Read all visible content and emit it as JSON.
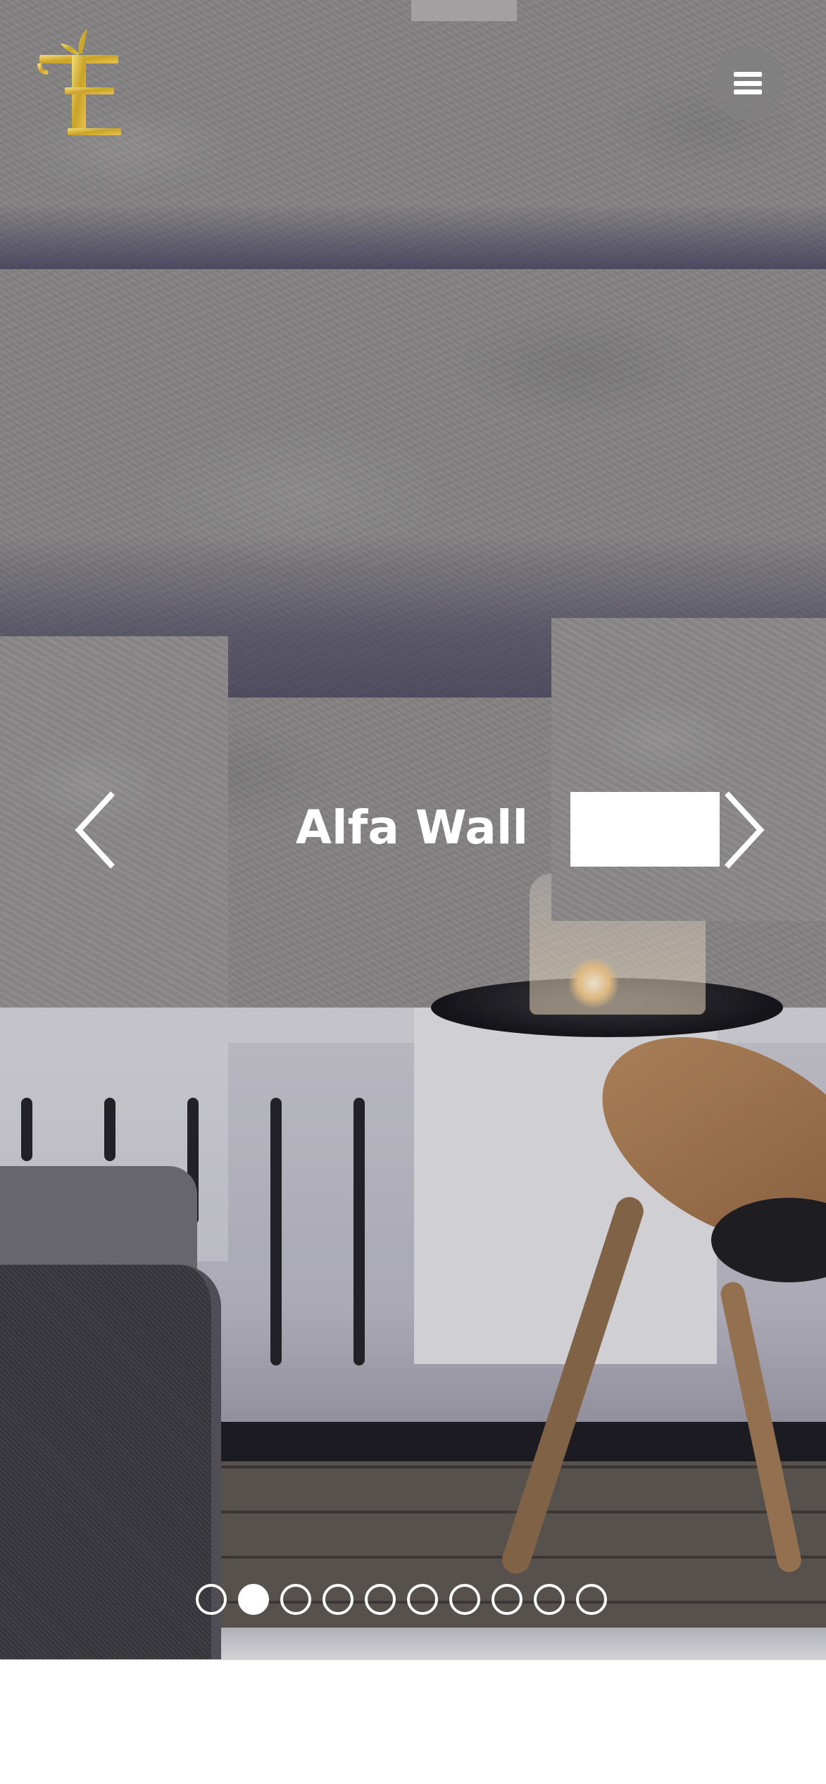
{
  "header": {
    "logo_icon": "gold-letter-e-sprout-logo",
    "menu_icon": "hamburger-menu-icon"
  },
  "slider": {
    "title": "Alfa Wall",
    "button_label": "",
    "prev_icon": "chevron-left-icon",
    "next_icon": "chevron-right-icon",
    "slide_count": 10,
    "active_index": 1
  },
  "colors": {
    "logo_gold": "#C9A227",
    "text": "#FFFFFF",
    "wall": "#8F8D8B",
    "accent_purple": "#46425F"
  }
}
